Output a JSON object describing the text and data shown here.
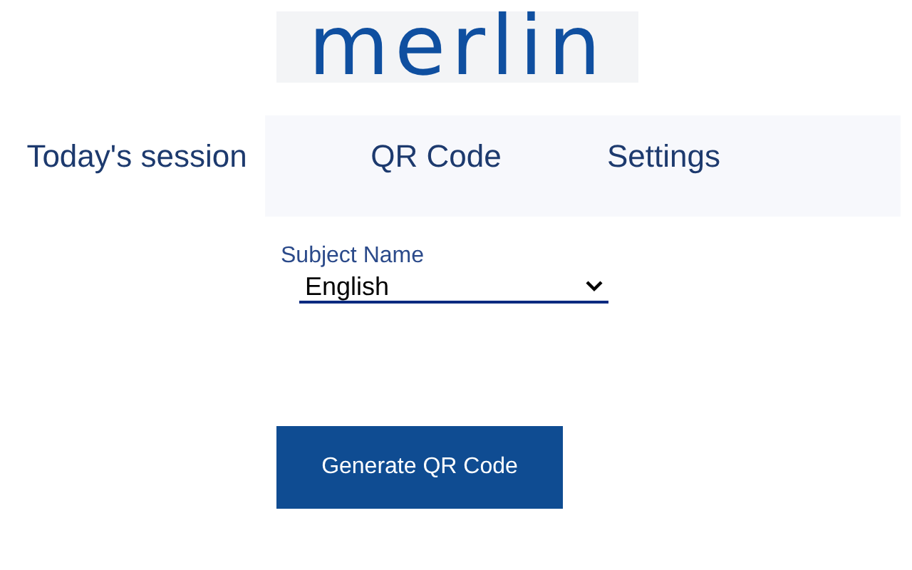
{
  "logo": {
    "text": "merlin"
  },
  "tabs": [
    {
      "label": "Today's session",
      "selected": true
    },
    {
      "label": "QR Code",
      "selected": false
    },
    {
      "label": "Settings",
      "selected": false
    }
  ],
  "subject_field": {
    "label": "Subject Name",
    "value": "English"
  },
  "generate_button": {
    "label": "Generate QR Code"
  }
}
